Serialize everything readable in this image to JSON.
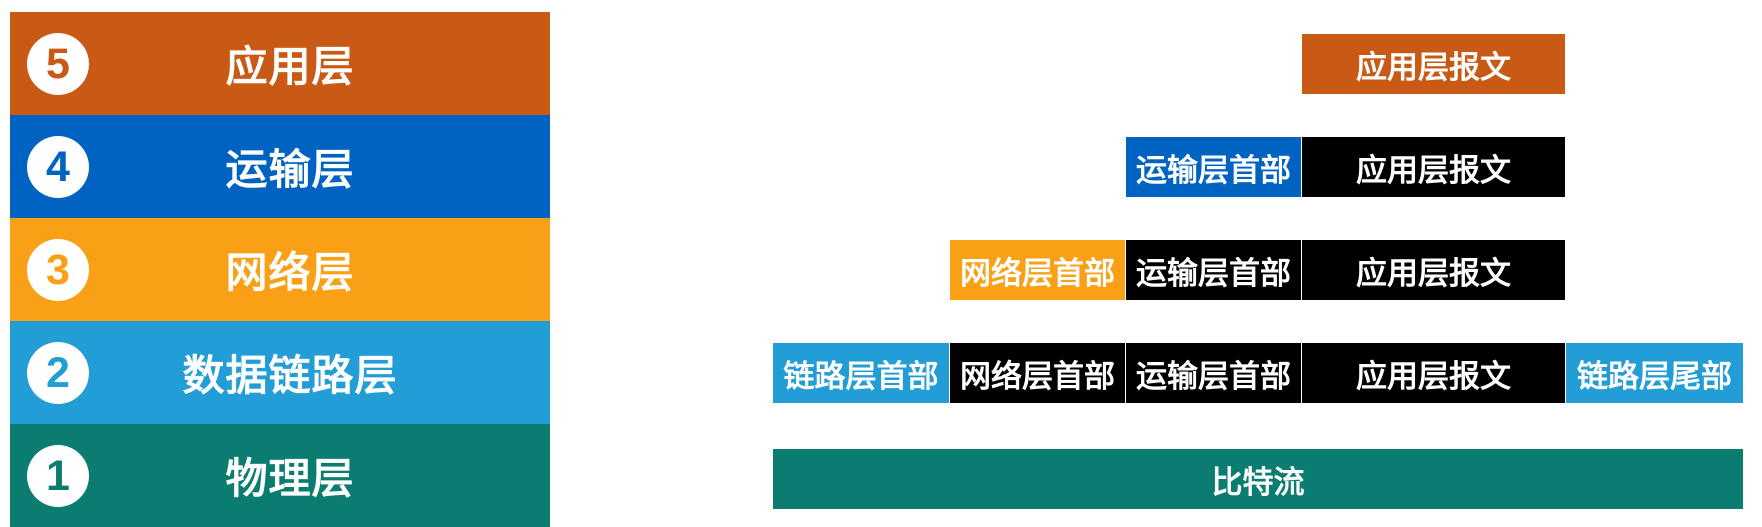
{
  "colors": {
    "application": "#C85A15",
    "transport": "#0063C2",
    "network": "#FAA016",
    "datalink": "#229DD5",
    "physical": "#0B7C70",
    "data_black": "#000000",
    "text_white": "#FFFFFF"
  },
  "layers": [
    {
      "number": "5",
      "name": "应用层"
    },
    {
      "number": "4",
      "name": "运输层"
    },
    {
      "number": "3",
      "name": "网络层"
    },
    {
      "number": "2",
      "name": "数据链路层"
    },
    {
      "number": "1",
      "name": "物理层"
    }
  ],
  "encapsulation": {
    "application_row": [
      "应用层报文"
    ],
    "transport_row": [
      "运输层首部",
      "应用层报文"
    ],
    "network_row": [
      "网络层首部",
      "运输层首部",
      "应用层报文"
    ],
    "datalink_row": [
      "链路层首部",
      "网络层首部",
      "运输层首部",
      "应用层报文",
      "链路层尾部"
    ],
    "physical_row": "比特流"
  }
}
